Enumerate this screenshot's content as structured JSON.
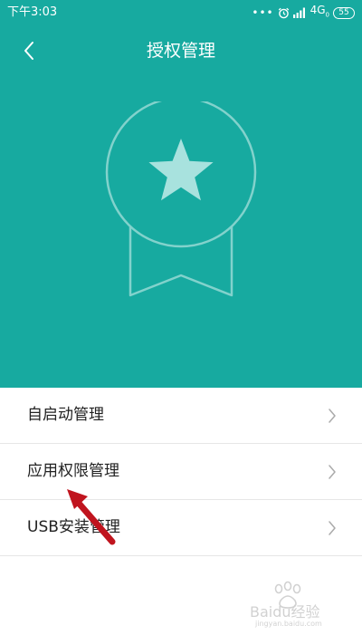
{
  "status_bar": {
    "time": "下午3:03",
    "notification_dots": "•••",
    "network": "4G",
    "network_sub": "0",
    "battery": "55"
  },
  "nav": {
    "title": "授权管理"
  },
  "menu": {
    "items": [
      {
        "label": "自启动管理"
      },
      {
        "label": "应用权限管理"
      },
      {
        "label": "USB安装管理"
      }
    ]
  },
  "watermark": {
    "text": "Baidu经验",
    "url_text": "jingyan.baidu.com"
  },
  "colors": {
    "header_bg": "#17aaa0",
    "badge_fill": "#a8e2de",
    "badge_stroke": "#82d2cc",
    "annotation_arrow": "#c0141e"
  },
  "icons": {
    "back": "chevron-left-icon",
    "menu_chevron": "chevron-right-icon",
    "badge": "star-ribbon-badge-icon",
    "alarm": "alarm-icon",
    "signal": "signal-bars-icon"
  }
}
